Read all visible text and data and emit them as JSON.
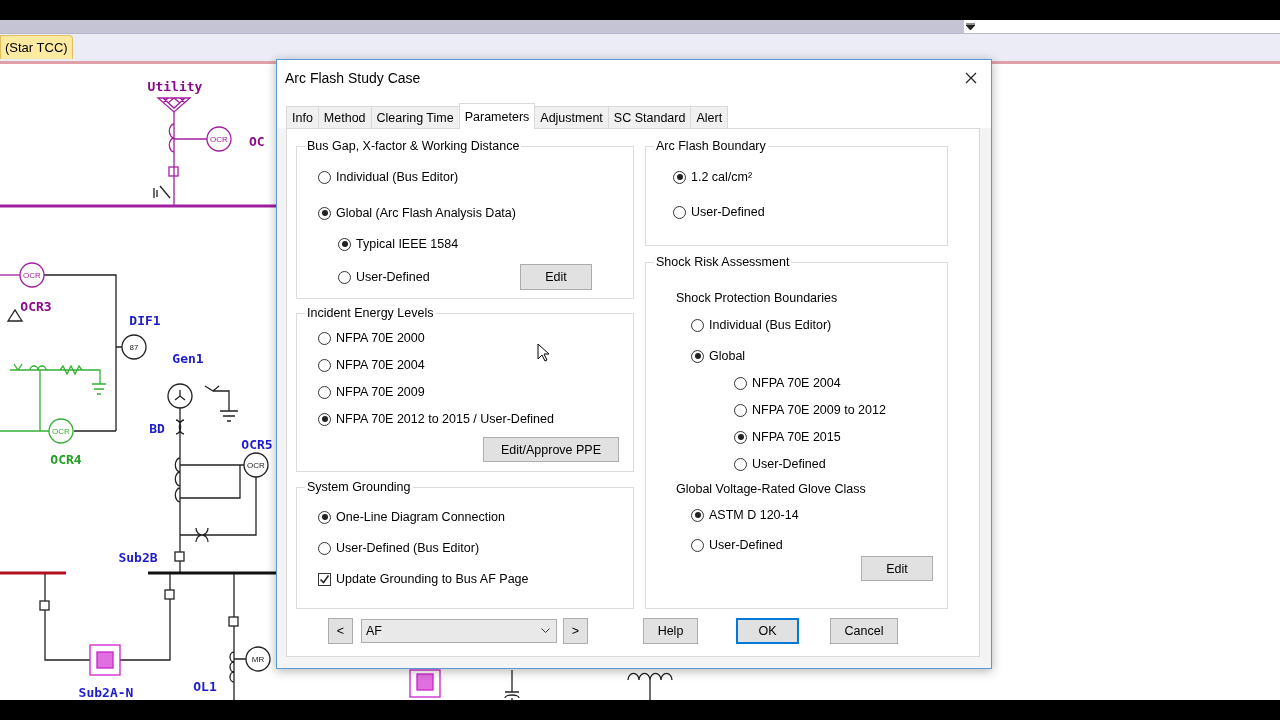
{
  "document_tab": {
    "label": "(Star TCC)",
    "selected": true
  },
  "diagram": {
    "labels": [
      {
        "text": "Utility",
        "color": "#8a0a8a"
      },
      {
        "text": "OC",
        "color": "#8a0a8a"
      },
      {
        "text": "OCR3",
        "color": "#8a0a8a"
      },
      {
        "text": "DIF1",
        "color": "#1c1ccc"
      },
      {
        "text": "Gen1",
        "color": "#1c1ccc"
      },
      {
        "text": "OCR4",
        "color": "#23a023"
      },
      {
        "text": "BD",
        "color": "#1c1ccc"
      },
      {
        "text": "OCR5",
        "color": "#1c1ccc"
      },
      {
        "text": "Sub2B",
        "color": "#1c1ccc"
      },
      {
        "text": "Sub2A-N",
        "color": "#1c1ccc"
      },
      {
        "text": "OL1",
        "color": "#1c1ccc"
      }
    ],
    "relays": [
      {
        "text": "OCR",
        "color": "#a020a0"
      },
      {
        "text": "OCR",
        "color": "#a020a0"
      },
      {
        "text": "87",
        "color": "#222222"
      },
      {
        "text": "OCR",
        "color": "#33b033"
      },
      {
        "text": "OCR",
        "color": "#222222"
      },
      {
        "text": "MR",
        "color": "#222222"
      }
    ]
  },
  "dialog": {
    "title": "Arc Flash Study Case",
    "tabs": [
      {
        "label": "Info",
        "selected": false
      },
      {
        "label": "Method",
        "selected": false
      },
      {
        "label": "Clearing Time",
        "selected": false
      },
      {
        "label": "Parameters",
        "selected": true
      },
      {
        "label": "Adjustment",
        "selected": false
      },
      {
        "label": "SC Standard",
        "selected": false
      },
      {
        "label": "Alert",
        "selected": false
      }
    ],
    "bus_gap": {
      "title": "Bus Gap, X-factor & Working Distance",
      "options": [
        {
          "label": "Individual (Bus Editor)",
          "selected": false
        },
        {
          "label": "Global (Arc Flash Analysis Data)",
          "selected": true
        }
      ],
      "sub_options": [
        {
          "label": "Typical IEEE 1584",
          "selected": true
        },
        {
          "label": "User-Defined",
          "selected": false
        }
      ],
      "button": "Edit"
    },
    "incident_energy": {
      "title": "Incident Energy Levels",
      "options": [
        {
          "label": "NFPA 70E 2000",
          "selected": false
        },
        {
          "label": "NFPA 70E 2004",
          "selected": false
        },
        {
          "label": "NFPA 70E 2009",
          "selected": false
        },
        {
          "label": "NFPA 70E 2012 to 2015 / User-Defined",
          "selected": true
        }
      ],
      "button": "Edit/Approve PPE"
    },
    "grounding": {
      "title": "System Grounding",
      "options": [
        {
          "label": "One-Line Diagram Connection",
          "selected": true
        },
        {
          "label": "User-Defined (Bus Editor)",
          "selected": false
        }
      ],
      "checkbox": {
        "label": "Update Grounding to Bus AF Page",
        "checked": true
      }
    },
    "boundary": {
      "title": "Arc Flash Boundary",
      "options": [
        {
          "label": "1.2 cal/cm²",
          "selected": true
        },
        {
          "label": "User-Defined",
          "selected": false
        }
      ]
    },
    "shock": {
      "title": "Shock Risk Assessment",
      "protection": {
        "title": "Shock Protection Boundaries",
        "options": [
          {
            "label": "Individual (Bus Editor)",
            "selected": false
          },
          {
            "label": "Global",
            "selected": true
          }
        ],
        "sub_options": [
          {
            "label": "NFPA 70E 2004",
            "selected": false
          },
          {
            "label": "NFPA 70E 2009 to 2012",
            "selected": false
          },
          {
            "label": "NFPA 70E 2015",
            "selected": true
          },
          {
            "label": "User-Defined",
            "selected": false
          }
        ]
      },
      "glove": {
        "title": "Global Voltage-Rated Glove Class",
        "options": [
          {
            "label": "ASTM D 120-14",
            "selected": true
          },
          {
            "label": "User-Defined",
            "selected": false
          }
        ]
      },
      "button": "Edit"
    },
    "footer": {
      "prev": "<",
      "combo": "AF",
      "next": ">",
      "buttons": [
        {
          "label": "Help",
          "default": false
        },
        {
          "label": "OK",
          "default": true
        },
        {
          "label": "Cancel",
          "default": false
        }
      ]
    }
  }
}
